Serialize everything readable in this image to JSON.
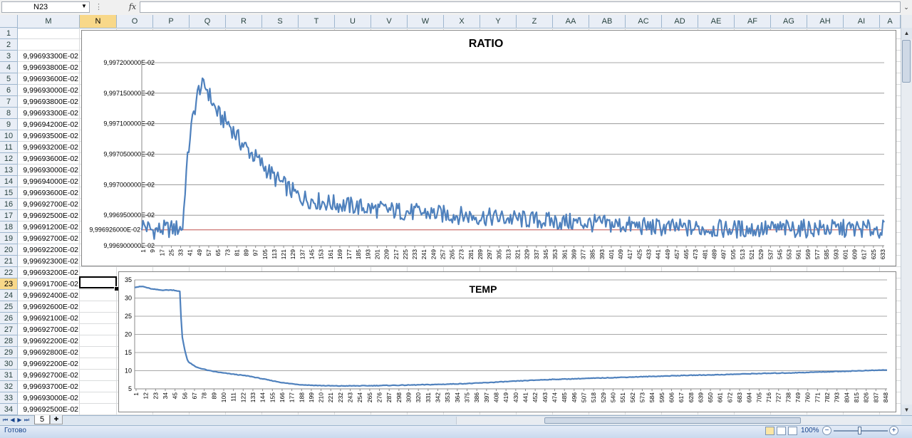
{
  "formula_bar": {
    "name_box": "N23",
    "fx_label": "fx",
    "formula": "",
    "name_box_arrow_icon": "dropdown-arrow-icon"
  },
  "columns": [
    "M",
    "N",
    "O",
    "P",
    "Q",
    "R",
    "S",
    "T",
    "U",
    "V",
    "W",
    "X",
    "Y",
    "Z",
    "AA",
    "AB",
    "AC",
    "AD",
    "AE",
    "AF",
    "AG",
    "AH",
    "AI",
    "A"
  ],
  "selected_column": "N",
  "rows": [
    {
      "n": "1",
      "m": ""
    },
    {
      "n": "2",
      "m": ""
    },
    {
      "n": "3",
      "m": "9,99693300E-02"
    },
    {
      "n": "4",
      "m": "9,99693800E-02"
    },
    {
      "n": "5",
      "m": "9,99693600E-02"
    },
    {
      "n": "6",
      "m": "9,99693000E-02"
    },
    {
      "n": "7",
      "m": "9,99693800E-02"
    },
    {
      "n": "8",
      "m": "9,99693300E-02"
    },
    {
      "n": "9",
      "m": "9,99694200E-02"
    },
    {
      "n": "10",
      "m": "9,99693500E-02"
    },
    {
      "n": "11",
      "m": "9,99693200E-02"
    },
    {
      "n": "12",
      "m": "9,99693600E-02"
    },
    {
      "n": "13",
      "m": "9,99693000E-02"
    },
    {
      "n": "14",
      "m": "9,99694000E-02"
    },
    {
      "n": "15",
      "m": "9,99693600E-02"
    },
    {
      "n": "16",
      "m": "9,99692700E-02"
    },
    {
      "n": "17",
      "m": "9,99692500E-02"
    },
    {
      "n": "18",
      "m": "9,99691200E-02"
    },
    {
      "n": "19",
      "m": "9,99692700E-02"
    },
    {
      "n": "20",
      "m": "9,99692200E-02"
    },
    {
      "n": "21",
      "m": "9,99692300E-02"
    },
    {
      "n": "22",
      "m": "9,99693200E-02"
    },
    {
      "n": "23",
      "m": "9,99691700E-02"
    },
    {
      "n": "24",
      "m": "9,99692400E-02"
    },
    {
      "n": "25",
      "m": "9,99692600E-02"
    },
    {
      "n": "26",
      "m": "9,99692100E-02"
    },
    {
      "n": "27",
      "m": "9,99692700E-02"
    },
    {
      "n": "28",
      "m": "9,99692200E-02"
    },
    {
      "n": "29",
      "m": "9,99692800E-02"
    },
    {
      "n": "30",
      "m": "9,99692200E-02"
    },
    {
      "n": "31",
      "m": "9,99692700E-02"
    },
    {
      "n": "32",
      "m": "9,99693700E-02"
    },
    {
      "n": "33",
      "m": "9,99693000E-02"
    },
    {
      "n": "34",
      "m": "9,99692500E-02"
    }
  ],
  "selected_row": "23",
  "sheet_tab": "5",
  "status": {
    "ready": "Готово",
    "zoom": "100%",
    "zoom_minus": "−",
    "zoom_plus": "+"
  },
  "chart_data": [
    {
      "type": "line",
      "title": "RATIO",
      "ylim": [
        0.099969,
        0.099972
      ],
      "yticks": [
        0.099969,
        0.0999695,
        0.09997,
        0.0999705,
        0.099971,
        0.0999715,
        0.099972
      ],
      "ytick_labels": [
        "9,996900000E-02",
        "9,996950000E-02",
        "9,997000000E-02",
        "9,997050000E-02",
        "9,997100000E-02",
        "9,997150000E-02",
        "9,997200000E-02"
      ],
      "reference_line": {
        "value": 0.09996926,
        "label": "9,996926000E-02",
        "color": "#c0504d"
      },
      "x_tick_labels": [
        "1",
        "9",
        "17",
        "25",
        "33",
        "41",
        "49",
        "57",
        "65",
        "73",
        "81",
        "89",
        "97",
        "105",
        "113",
        "121",
        "129",
        "137",
        "145",
        "153",
        "161",
        "169",
        "177",
        "185",
        "193",
        "201",
        "209",
        "217",
        "225",
        "233",
        "241",
        "249",
        "257",
        "265",
        "273",
        "281",
        "289",
        "297",
        "305",
        "313",
        "321",
        "329",
        "337",
        "345",
        "353",
        "361",
        "369",
        "377",
        "385",
        "393",
        "401",
        "409",
        "417",
        "425",
        "433",
        "441",
        "449",
        "457",
        "465",
        "473",
        "481",
        "489",
        "497",
        "505",
        "513",
        "521",
        "529",
        "537",
        "545",
        "553",
        "561",
        "569",
        "577",
        "585",
        "593",
        "601",
        "609",
        "617",
        "625",
        "633"
      ],
      "series": [
        {
          "color": "#4f81bd",
          "points": [
            [
              1,
              0.09996935
            ],
            [
              10,
              0.09996925
            ],
            [
              20,
              0.09996927
            ],
            [
              30,
              0.09996928
            ],
            [
              36,
              0.0999693
            ],
            [
              38,
              0.09997
            ],
            [
              42,
              0.0999708
            ],
            [
              46,
              0.09997125
            ],
            [
              50,
              0.0999716
            ],
            [
              56,
              0.0999716
            ],
            [
              62,
              0.0999713
            ],
            [
              68,
              0.0999711
            ],
            [
              75,
              0.099971
            ],
            [
              85,
              0.0999707
            ],
            [
              95,
              0.0999705
            ],
            [
              105,
              0.0999703
            ],
            [
              115,
              0.0999701
            ],
            [
              125,
              0.09996995
            ],
            [
              135,
              0.0999698
            ],
            [
              145,
              0.09996975
            ],
            [
              160,
              0.0999697
            ],
            [
              180,
              0.09996965
            ],
            [
              200,
              0.0999696
            ],
            [
              230,
              0.09996955
            ],
            [
              270,
              0.0999695
            ],
            [
              310,
              0.09996945
            ],
            [
              350,
              0.0999694
            ],
            [
              400,
              0.09996935
            ],
            [
              440,
              0.0999693
            ],
            [
              480,
              0.09996928
            ],
            [
              520,
              0.09996927
            ],
            [
              560,
              0.09996928
            ],
            [
              600,
              0.09996928
            ],
            [
              633,
              0.09996927
            ]
          ]
        }
      ]
    },
    {
      "type": "line",
      "title": "TEMP",
      "ylim": [
        5,
        35
      ],
      "yticks": [
        5,
        10,
        15,
        20,
        25,
        30,
        35
      ],
      "x_tick_labels": [
        "1",
        "12",
        "23",
        "34",
        "45",
        "56",
        "67",
        "78",
        "89",
        "100",
        "111",
        "122",
        "133",
        "144",
        "155",
        "166",
        "177",
        "188",
        "199",
        "210",
        "221",
        "232",
        "243",
        "254",
        "265",
        "276",
        "287",
        "298",
        "309",
        "320",
        "331",
        "342",
        "353",
        "364",
        "375",
        "386",
        "397",
        "408",
        "419",
        "430",
        "441",
        "452",
        "463",
        "474",
        "485",
        "496",
        "507",
        "518",
        "529",
        "540",
        "551",
        "562",
        "573",
        "584",
        "595",
        "606",
        "617",
        "628",
        "639",
        "650",
        "661",
        "672",
        "683",
        "694",
        "705",
        "716",
        "727",
        "738",
        "749",
        "760",
        "771",
        "782",
        "793",
        "804",
        "815",
        "826",
        "837",
        "848"
      ],
      "series": [
        {
          "color": "#4f81bd",
          "points": [
            [
              1,
              33
            ],
            [
              10,
              33.2
            ],
            [
              20,
              32.5
            ],
            [
              30,
              32.2
            ],
            [
              45,
              32.2
            ],
            [
              52,
              31.8
            ],
            [
              54,
              20
            ],
            [
              58,
              15
            ],
            [
              61,
              12.5
            ],
            [
              70,
              11
            ],
            [
              85,
              10
            ],
            [
              100,
              9.4
            ],
            [
              130,
              8.5
            ],
            [
              150,
              7.5
            ],
            [
              170,
              6.6
            ],
            [
              190,
              6.1
            ],
            [
              210,
              5.9
            ],
            [
              230,
              5.8
            ],
            [
              260,
              5.85
            ],
            [
              300,
              6
            ],
            [
              340,
              6.2
            ],
            [
              380,
              6.5
            ],
            [
              420,
              7
            ],
            [
              460,
              7.5
            ],
            [
              500,
              7.8
            ],
            [
              540,
              8.1
            ],
            [
              580,
              8.4
            ],
            [
              620,
              8.7
            ],
            [
              660,
              8.9
            ],
            [
              700,
              9.2
            ],
            [
              740,
              9.4
            ],
            [
              780,
              9.7
            ],
            [
              820,
              10
            ],
            [
              848,
              10.2
            ]
          ]
        }
      ]
    }
  ]
}
